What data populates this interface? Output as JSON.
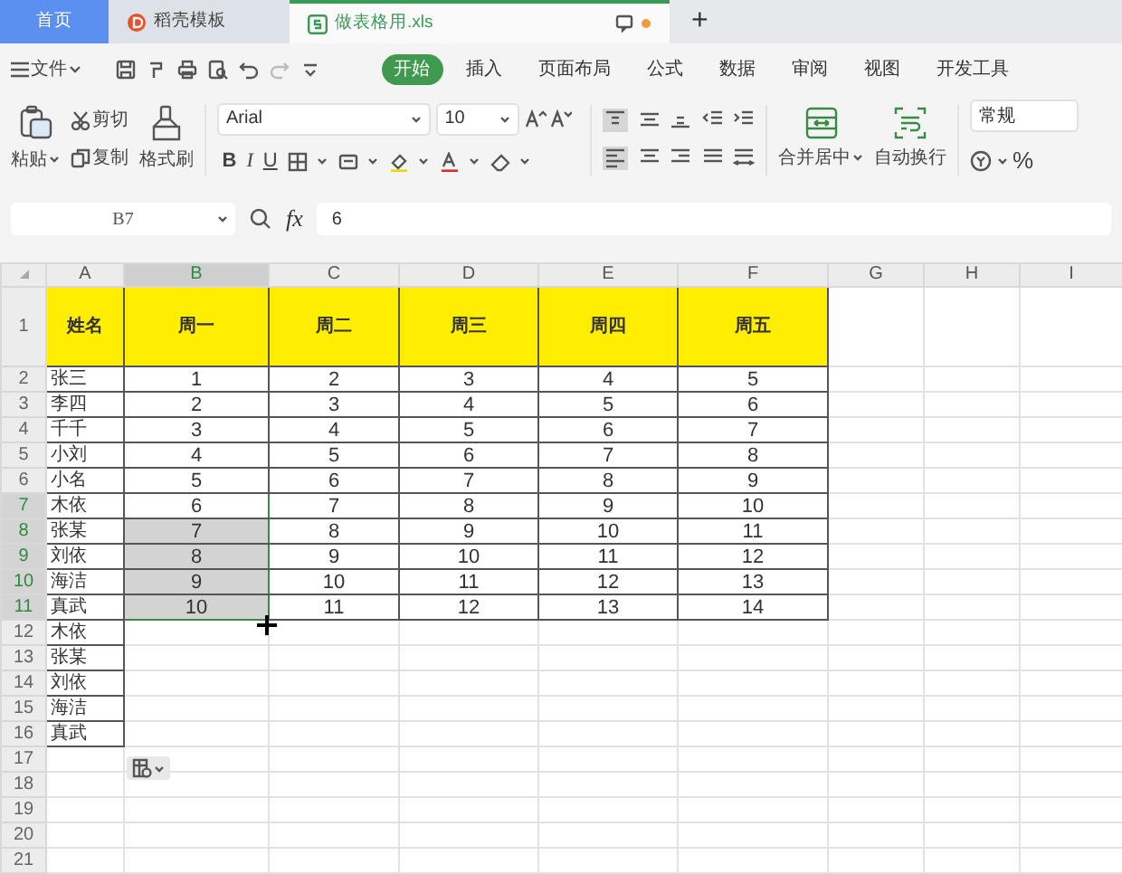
{
  "tabs": [
    {
      "label": "首页",
      "kind": "home",
      "selected": false
    },
    {
      "label": "稻壳模板",
      "kind": "app",
      "selected": false
    },
    {
      "label": "做表格用.xls",
      "kind": "doc",
      "selected": true
    }
  ],
  "new_tab": "+",
  "menu": {
    "file": "文件",
    "ribbon_tabs": [
      {
        "label": "开始",
        "selected": true
      },
      {
        "label": "插入",
        "selected": false
      },
      {
        "label": "页面布局",
        "selected": false
      },
      {
        "label": "公式",
        "selected": false
      },
      {
        "label": "数据",
        "selected": false
      },
      {
        "label": "审阅",
        "selected": false
      },
      {
        "label": "视图",
        "selected": false
      },
      {
        "label": "开发工具",
        "selected": false
      }
    ]
  },
  "toolbar": {
    "paste": "粘贴",
    "cut": "剪切",
    "copy": "复制",
    "format_painter": "格式刷",
    "font": "Arial",
    "size": "10",
    "bold": "B",
    "italic": "I",
    "underline": "U",
    "merge": "合并居中",
    "wrap": "自动换行",
    "number_format": "常规",
    "percent": "%"
  },
  "formula_bar": {
    "cell_ref": "B7",
    "fx": "fx",
    "value": "6"
  },
  "columns": [
    {
      "label": "A",
      "selected": false
    },
    {
      "label": "B",
      "selected": true
    },
    {
      "label": "C",
      "selected": false
    },
    {
      "label": "D",
      "selected": false
    },
    {
      "label": "E",
      "selected": false
    },
    {
      "label": "F",
      "selected": false
    },
    {
      "label": "G",
      "selected": false
    },
    {
      "label": "H",
      "selected": false
    },
    {
      "label": "I",
      "selected": false
    }
  ],
  "rows": [
    {
      "number": "1",
      "kind": "header",
      "selected": false,
      "cells": [
        "姓名",
        "周一",
        "周二",
        "周三",
        "周四",
        "周五"
      ]
    },
    {
      "number": "2",
      "kind": "data",
      "selected": false,
      "cells": [
        "张三",
        "1",
        "2",
        "3",
        "4",
        "5"
      ]
    },
    {
      "number": "3",
      "kind": "data",
      "selected": false,
      "cells": [
        "李四",
        "2",
        "3",
        "4",
        "5",
        "6"
      ]
    },
    {
      "number": "4",
      "kind": "data",
      "selected": false,
      "cells": [
        "千千",
        "3",
        "4",
        "5",
        "6",
        "7"
      ]
    },
    {
      "number": "5",
      "kind": "data",
      "selected": false,
      "cells": [
        "小刘",
        "4",
        "5",
        "6",
        "7",
        "8"
      ]
    },
    {
      "number": "6",
      "kind": "data",
      "selected": false,
      "cells": [
        "小名",
        "5",
        "6",
        "7",
        "8",
        "9"
      ]
    },
    {
      "number": "7",
      "kind": "data",
      "selected": true,
      "cells": [
        "木依",
        "6",
        "7",
        "8",
        "9",
        "10"
      ]
    },
    {
      "number": "8",
      "kind": "data",
      "selected": true,
      "cells": [
        "张某",
        "7",
        "8",
        "9",
        "10",
        "11"
      ]
    },
    {
      "number": "9",
      "kind": "data",
      "selected": true,
      "cells": [
        "刘依",
        "8",
        "9",
        "10",
        "11",
        "12"
      ]
    },
    {
      "number": "10",
      "kind": "data",
      "selected": true,
      "cells": [
        "海洁",
        "9",
        "10",
        "11",
        "12",
        "13"
      ]
    },
    {
      "number": "11",
      "kind": "data",
      "selected": true,
      "cells": [
        "真武",
        "10",
        "11",
        "12",
        "13",
        "14"
      ]
    },
    {
      "number": "12",
      "kind": "data",
      "selected": false,
      "cells": [
        "木依"
      ]
    },
    {
      "number": "13",
      "kind": "data",
      "selected": false,
      "cells": [
        "张某"
      ]
    },
    {
      "number": "14",
      "kind": "data",
      "selected": false,
      "cells": [
        "刘依"
      ]
    },
    {
      "number": "15",
      "kind": "data",
      "selected": false,
      "cells": [
        "海洁"
      ]
    },
    {
      "number": "16",
      "kind": "data",
      "selected": false,
      "cells": [
        "真武"
      ]
    },
    {
      "number": "17",
      "kind": "data",
      "selected": false
    },
    {
      "number": "18",
      "kind": "data",
      "selected": false
    },
    {
      "number": "19",
      "kind": "data",
      "selected": false
    },
    {
      "number": "20",
      "kind": "data",
      "selected": false
    },
    {
      "number": "21",
      "kind": "data",
      "selected": false
    }
  ]
}
